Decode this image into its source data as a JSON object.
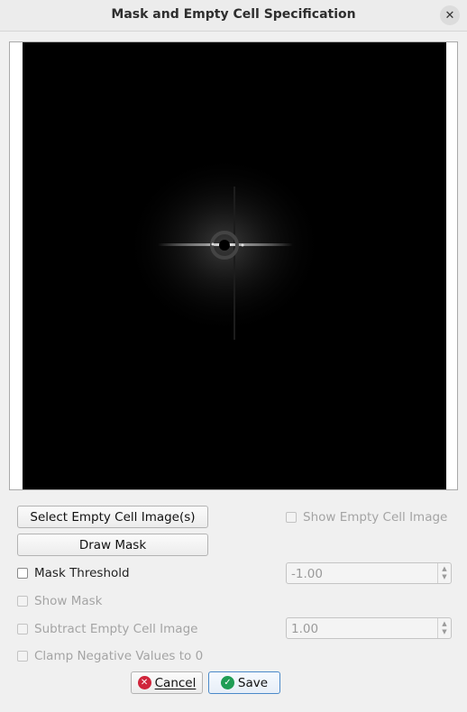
{
  "window": {
    "title": "Mask and Empty Cell Specification",
    "close_icon": "close-icon"
  },
  "buttons": {
    "select_empty_cell": "Select Empty Cell Image(s)",
    "draw_mask": "Draw Mask",
    "cancel": "Cancel",
    "save": "Save"
  },
  "checkboxes": {
    "show_empty_cell_image": "Show Empty Cell Image",
    "mask_threshold": "Mask Threshold",
    "show_mask": "Show Mask",
    "subtract_empty_cell_image": "Subtract Empty Cell Image",
    "clamp_negative": "Clamp Negative Values to 0"
  },
  "inputs": {
    "mask_threshold_value": "-1.00",
    "subtract_scale_value": "1.00"
  },
  "colors": {
    "cancel_icon": "#d0253b",
    "save_icon": "#1f9d55",
    "save_border": "#4a89c9"
  }
}
